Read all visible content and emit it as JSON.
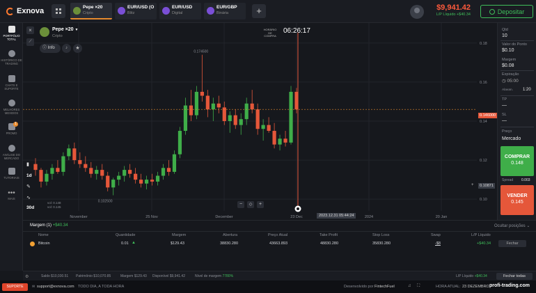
{
  "brand": {
    "name": "Exnova"
  },
  "tabs": [
    {
      "label": "Pepe ×20",
      "sub": "Cripto",
      "color": "#6b8f3a",
      "active": true
    },
    {
      "label": "EUR/USD (O...",
      "sub": "Blitz",
      "color": "#7a4fd6",
      "active": false
    },
    {
      "label": "EUR/USD",
      "sub": "Digital",
      "color": "#7a4fd6",
      "active": false
    },
    {
      "label": "EUR/GBP",
      "sub": "Binária",
      "color": "#7a4fd6",
      "active": false
    }
  ],
  "account": {
    "balance": "$9,941.42",
    "pl": "L/P Líquido +$40.34",
    "deposit_label": "Depositar"
  },
  "sidebar": {
    "items": [
      {
        "label": "PORTFÓLIO TOTAL",
        "icon": "briefcase-icon",
        "active": true
      },
      {
        "label": "HISTÓRICO DE TRADING",
        "icon": "history-icon",
        "active": false
      },
      {
        "label": "CHATS E SUPORTE",
        "icon": "chat-icon",
        "active": false
      },
      {
        "label": "MELHORES MEXIDOS",
        "icon": "trophy-icon",
        "active": false
      },
      {
        "label": "PROMO",
        "icon": "gift-icon",
        "active": false
      },
      {
        "label": "ANÁLISE DO MERCADO",
        "icon": "analysis-icon",
        "active": false
      },
      {
        "label": "TUTORIAIS",
        "icon": "tutorial-icon",
        "active": false
      },
      {
        "label": "MAIS",
        "icon": "more-icon",
        "active": false
      }
    ],
    "promo_badge": "1"
  },
  "asset": {
    "name": "Pepe ×20",
    "type": "Cripto",
    "info_label": "Info"
  },
  "chart_data": {
    "type": "candlestick",
    "y_ticks": [
      0.18,
      0.16,
      0.14,
      0.12,
      0.1
    ],
    "ylim": [
      0.094,
      0.186
    ],
    "x_ticks": [
      "November",
      "25 Nov",
      "December",
      "23 Dec",
      "2024",
      "20 Jan"
    ],
    "current_price": 0.146,
    "current_price_label": "0.146000",
    "other_price_label": "0.10871",
    "max_label": "0.174500",
    "min_label": "0.102500",
    "purchase_time_label": "HORÁRIO DE COMPRA",
    "timer": "06:26:17",
    "cursor_date": "2023.12.31 05:44:24",
    "ohlc_label1": "vol: 0.148",
    "ohlc_label2": "vol: 0.145",
    "timeframe": "1d",
    "period": "30d",
    "candles": [
      [
        0.118,
        0.121,
        0.112,
        0.115
      ],
      [
        0.115,
        0.116,
        0.106,
        0.109
      ],
      [
        0.109,
        0.115,
        0.107,
        0.113
      ],
      [
        0.113,
        0.118,
        0.11,
        0.116
      ],
      [
        0.116,
        0.12,
        0.113,
        0.114
      ],
      [
        0.114,
        0.124,
        0.112,
        0.122
      ],
      [
        0.122,
        0.128,
        0.12,
        0.126
      ],
      [
        0.126,
        0.129,
        0.118,
        0.12
      ],
      [
        0.12,
        0.124,
        0.116,
        0.118
      ],
      [
        0.118,
        0.122,
        0.114,
        0.116
      ],
      [
        0.116,
        0.119,
        0.111,
        0.113
      ],
      [
        0.113,
        0.117,
        0.11,
        0.115
      ],
      [
        0.115,
        0.118,
        0.11,
        0.112
      ],
      [
        0.112,
        0.114,
        0.104,
        0.106
      ],
      [
        0.106,
        0.111,
        0.102,
        0.11
      ],
      [
        0.11,
        0.114,
        0.107,
        0.112
      ],
      [
        0.112,
        0.117,
        0.109,
        0.115
      ],
      [
        0.115,
        0.118,
        0.111,
        0.113
      ],
      [
        0.113,
        0.116,
        0.108,
        0.11
      ],
      [
        0.11,
        0.113,
        0.106,
        0.108
      ],
      [
        0.108,
        0.112,
        0.105,
        0.11
      ],
      [
        0.11,
        0.113,
        0.107,
        0.109
      ],
      [
        0.109,
        0.114,
        0.107,
        0.112
      ],
      [
        0.112,
        0.118,
        0.11,
        0.116
      ],
      [
        0.116,
        0.12,
        0.112,
        0.114
      ],
      [
        0.114,
        0.125,
        0.113,
        0.123
      ],
      [
        0.123,
        0.137,
        0.121,
        0.135
      ],
      [
        0.135,
        0.152,
        0.133,
        0.148
      ],
      [
        0.148,
        0.156,
        0.14,
        0.143
      ],
      [
        0.143,
        0.158,
        0.141,
        0.155
      ],
      [
        0.155,
        0.174,
        0.15,
        0.153
      ],
      [
        0.153,
        0.156,
        0.142,
        0.146
      ],
      [
        0.146,
        0.152,
        0.14,
        0.149
      ],
      [
        0.149,
        0.153,
        0.144,
        0.147
      ],
      [
        0.147,
        0.15,
        0.138,
        0.14
      ],
      [
        0.14,
        0.145,
        0.134,
        0.143
      ],
      [
        0.143,
        0.146,
        0.136,
        0.138
      ],
      [
        0.138,
        0.144,
        0.133,
        0.141
      ],
      [
        0.141,
        0.152,
        0.138,
        0.149
      ],
      [
        0.149,
        0.156,
        0.144,
        0.146
      ],
      [
        0.146,
        0.149,
        0.133,
        0.136
      ],
      [
        0.136,
        0.141,
        0.13,
        0.138
      ],
      [
        0.138,
        0.142,
        0.134,
        0.135
      ],
      [
        0.135,
        0.139,
        0.126,
        0.128
      ],
      [
        0.128,
        0.133,
        0.125,
        0.131
      ],
      [
        0.131,
        0.135,
        0.127,
        0.129
      ],
      [
        0.129,
        0.158,
        0.128,
        0.155
      ],
      [
        0.155,
        0.157,
        0.144,
        0.146
      ]
    ],
    "up_color": "#3fae49",
    "down_color": "#e5573a"
  },
  "chart_controls": {
    "zoom_out": "−",
    "reset": "◇",
    "zoom_in": "+"
  },
  "trade_panel": {
    "qty_label": "Qtd",
    "qty": "10",
    "point_value_label": "Valor do Ponto",
    "point_value": "$0.10",
    "margin_label": "Margem",
    "margin": "$0.08",
    "expiration_label": "Expiração",
    "expiration": "05:00",
    "leverage_label": "Alavan.",
    "leverage": "1:20",
    "tp_label": "TP",
    "tp": "—",
    "sl_label": "SL",
    "sl": "—",
    "price_label": "Preço",
    "price_type": "Mercado",
    "buy_label": "COMPRAR",
    "buy_price": "0.148",
    "spread_label": "Spread",
    "spread": "0.003",
    "sell_label": "VENDER",
    "sell_price": "0.145"
  },
  "positions": {
    "title": "Margem (1)",
    "title_pl": "+$40.34",
    "hide_label": "Ocultar posições",
    "columns": [
      "Nome",
      "Quantidade",
      "Margem",
      "Abertura",
      "Preço Atual",
      "Take Profit",
      "Stop Loss",
      "Swap",
      "L/P Líquido"
    ],
    "rows": [
      {
        "name": "Bitcoin",
        "qty": "0.01",
        "margin": "$129.43",
        "open": "38830.280",
        "current": "43663.893",
        "tp": "48830.280",
        "sl": "35830.280",
        "swap": "-$8",
        "pl": "+$40.34",
        "action": "Fechar"
      }
    ]
  },
  "status": {
    "balance": "Saldo $10,030.51",
    "equity": "Patrimônio $10,070.85",
    "margin": "Margem $129.43",
    "available": "Disponível $9,941.42",
    "margin_level": "Nível de margem",
    "margin_level_val": "7780%",
    "pl": "L/P Líquido",
    "pl_val": "+$40.34",
    "close_all": "Fechar todas"
  },
  "footer": {
    "support": "SUPORTE",
    "email": "support@exnova.com",
    "slogan": "TODO DIA, A TODA HORA",
    "powered": "Desenvolvido por",
    "powered_by": "FintechFuel",
    "time_label": "HORA ATUAL:",
    "time": "23 DEZEMBRO",
    "watermark": "profi-trading.com"
  }
}
